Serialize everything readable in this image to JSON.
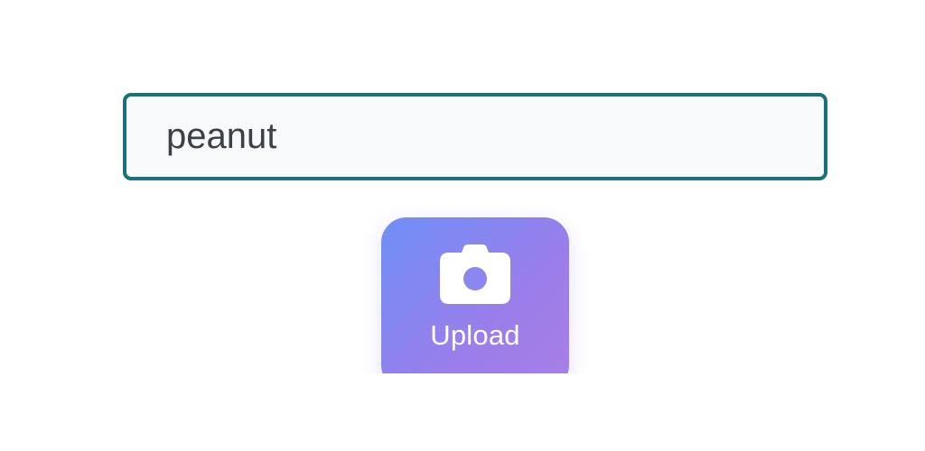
{
  "search": {
    "value": "peanut"
  },
  "upload": {
    "label": "Upload",
    "icon": "camera-icon"
  },
  "colors": {
    "input_border": "#17727a",
    "input_background": "#f8f9fa",
    "input_text": "#3b4049",
    "button_gradient_start": "#6f8ff8",
    "button_gradient_end": "#a97fe6"
  }
}
